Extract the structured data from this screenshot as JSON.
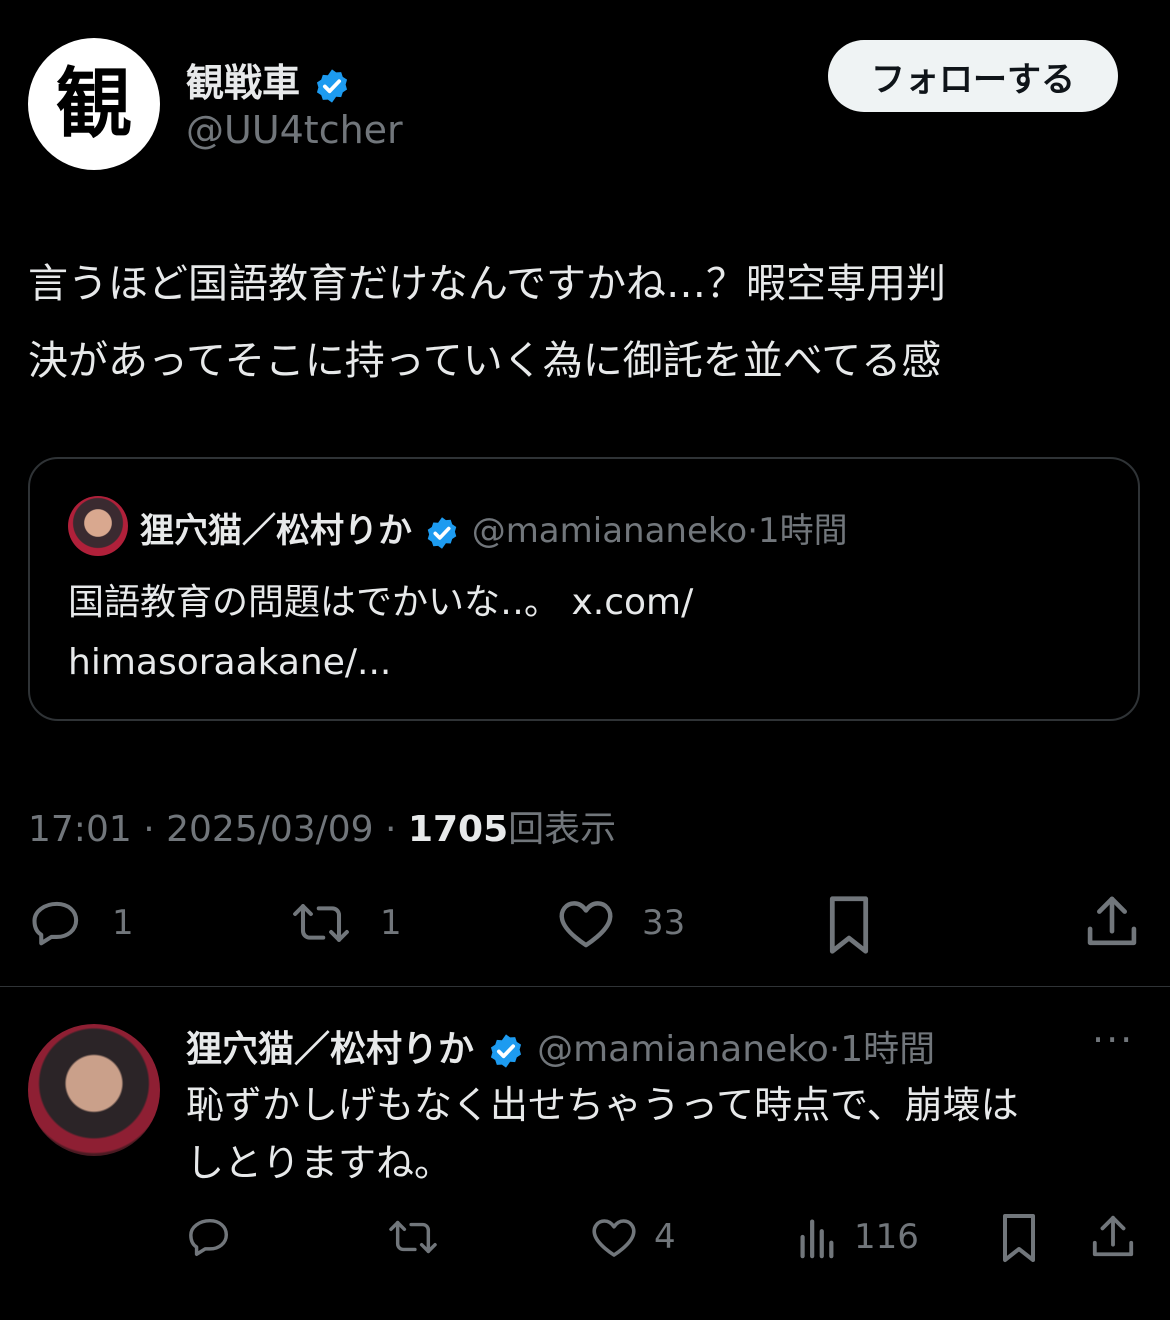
{
  "tweet": {
    "author_display": "観戦車",
    "author_handle": "@UU4tcher",
    "avatar_glyph": "観",
    "follow_label": "フォローする",
    "text_line1": "言うほど国語教育だけなんですかね…？暇空専用判",
    "text_line2": "決があってそこに持っていく為に御託を並べてる感",
    "quote": {
      "author_display": "狸穴猫／松村りか",
      "author_handle": "@mamiananeko",
      "time": "1時間",
      "text_line1": "国語教育の問題はでかいな‥。 x.com/",
      "text_line2": "himasoraakane/..."
    },
    "time": "17:01",
    "date": "2025/03/09",
    "views_count": "1705",
    "views_label": "回表示",
    "stats": {
      "replies": "1",
      "retweets": "1",
      "likes": "33"
    }
  },
  "reply": {
    "author_display": "狸穴猫／松村りか",
    "author_handle": "@mamiananeko",
    "time": "1時間",
    "text_line1": "恥ずかしげもなく出せちゃうって時点で、崩壊は",
    "text_line2": "しとりますね。",
    "stats": {
      "likes": "4",
      "views": "116"
    }
  },
  "colors": {
    "background": "#000000",
    "text": "#e7e9ea",
    "muted": "#71767b",
    "verified": "#1d9bf0",
    "border": "#2f3336"
  }
}
